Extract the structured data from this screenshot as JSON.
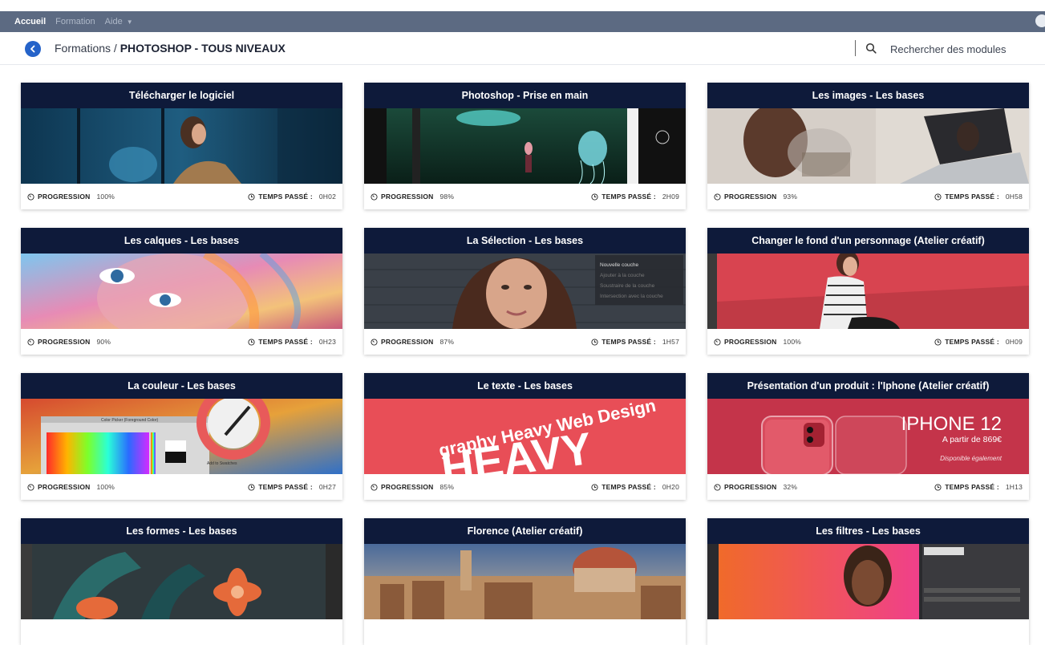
{
  "topbar": {
    "items": [
      {
        "label": "Accueil"
      },
      {
        "label": "Formation"
      },
      {
        "label": "Aide"
      }
    ]
  },
  "breadcrumb": {
    "parent": "Formations",
    "separator": " / ",
    "current": "PHOTOSHOP - TOUS NIVEAUX"
  },
  "search": {
    "placeholder": "Rechercher des modules"
  },
  "labels": {
    "progression": "PROGRESSION",
    "time": "TEMPS PASSÉ :"
  },
  "colors": {
    "topbar": "#5c6a82",
    "card_header": "#0e1a3a",
    "back_button": "#2563c9"
  },
  "cards": [
    {
      "title": "Télécharger le logiciel",
      "progress": "100%",
      "time": "0H02"
    },
    {
      "title": "Photoshop - Prise en main",
      "progress": "98%",
      "time": "2H09"
    },
    {
      "title": "Les images - Les bases",
      "progress": "93%",
      "time": "0H58"
    },
    {
      "title": "Les calques - Les bases",
      "progress": "90%",
      "time": "0H23"
    },
    {
      "title": "La Sélection - Les bases",
      "progress": "87%",
      "time": "1H57"
    },
    {
      "title": "Changer le fond d'un personnage (Atelier créatif)",
      "progress": "100%",
      "time": "0H09"
    },
    {
      "title": "La couleur - Les bases",
      "progress": "100%",
      "time": "0H27"
    },
    {
      "title": "Le texte - Les bases",
      "progress": "85%",
      "time": "0H20"
    },
    {
      "title": "Présentation d'un produit : l'Iphone (Atelier créatif)",
      "progress": "32%",
      "time": "1H13"
    },
    {
      "title": "Les formes - Les bases"
    },
    {
      "title": "Florence (Atelier créatif)"
    },
    {
      "title": "Les filtres - Les bases"
    }
  ],
  "image_texts": {
    "selection_menu": [
      "Nouvelle couche",
      "Ajouter à la couche",
      "Soustraire de la couche",
      "Intersection avec la couche"
    ],
    "color_picker_title": "Color Picker (Foreground Color)",
    "color_picker_button": "Add to Swatches",
    "text_word": "HEAVY",
    "text_line": "graphy Heavy Web Design",
    "iphone_title": "IPHONE 12",
    "iphone_price": "A partir de 869€",
    "iphone_avail": "Disponible également"
  }
}
